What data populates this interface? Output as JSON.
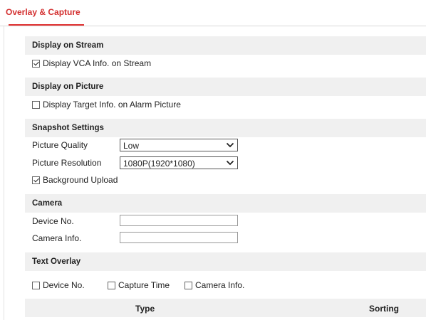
{
  "tabs": [
    {
      "label": "Overlay & Capture"
    }
  ],
  "sections": {
    "display_stream": {
      "title": "Display on Stream",
      "vca_info": {
        "label": "Display VCA Info. on Stream",
        "checked": true
      }
    },
    "display_picture": {
      "title": "Display on Picture",
      "target_info": {
        "label": "Display Target Info. on Alarm Picture",
        "checked": false
      }
    },
    "snapshot": {
      "title": "Snapshot Settings",
      "quality": {
        "label": "Picture Quality",
        "value": "Low"
      },
      "resolution": {
        "label": "Picture Resolution",
        "value": "1080P(1920*1080)"
      },
      "bg_upload": {
        "label": "Background Upload",
        "checked": true
      }
    },
    "camera": {
      "title": "Camera",
      "device_no": {
        "label": "Device No.",
        "value": ""
      },
      "camera_info": {
        "label": "Camera Info.",
        "value": ""
      }
    },
    "text_overlay": {
      "title": "Text Overlay",
      "options": [
        {
          "label": "Device No.",
          "checked": false
        },
        {
          "label": "Capture Time",
          "checked": false
        },
        {
          "label": "Camera Info.",
          "checked": false
        }
      ],
      "table_headers": [
        "Type",
        "Sorting"
      ]
    }
  },
  "icons": {
    "select_chevron": "chevron-down-icon"
  },
  "colors": {
    "accent": "#e03131",
    "section_bg": "#f0f0f0"
  }
}
